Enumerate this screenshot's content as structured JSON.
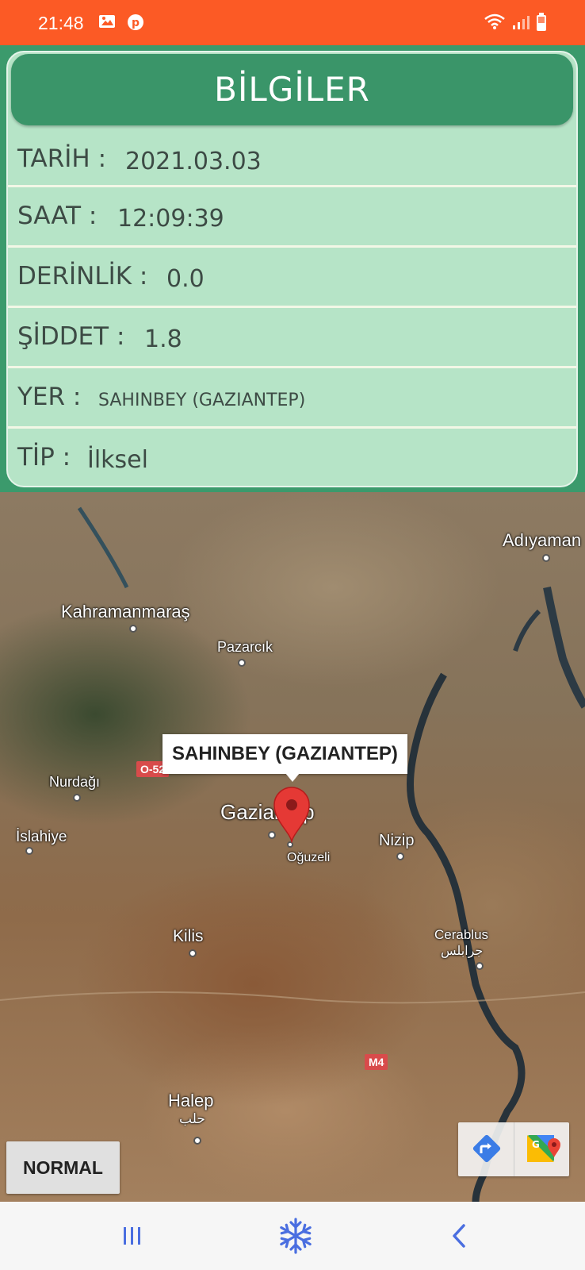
{
  "status_bar": {
    "time": "21:48",
    "left_icons": [
      "image-icon",
      "pinterest-icon"
    ],
    "right_icons": [
      "wifi-icon",
      "signal-icon",
      "battery-icon"
    ],
    "color": "#fc5a25"
  },
  "info_panel": {
    "title": "BİLGİLER",
    "rows": [
      {
        "label": "TARİH :",
        "value": "2021.03.03"
      },
      {
        "label": "SAAT :",
        "value": "12:09:39"
      },
      {
        "label": "DERİNLİK :",
        "value": "0.0"
      },
      {
        "label": "ŞİDDET :",
        "value": "1.8"
      },
      {
        "label": "YER :",
        "value": "SAHINBEY (GAZIANTEP)"
      },
      {
        "label": "TİP :",
        "value": "İlksel"
      }
    ],
    "header_color": "#3a9569",
    "panel_color": "#b6e4c7"
  },
  "map": {
    "marker_title": "SAHINBEY (GAZIANTEP)",
    "places": [
      "Adıyaman",
      "Kahramanmaraş",
      "Pazarcık",
      "Nurdağı",
      "İslahiye",
      "Gaziantep",
      "Oğuzeli",
      "Nizip",
      "Kilis",
      "Cerablus",
      "جرابلس",
      "Halep",
      "حلب"
    ],
    "road_badges": [
      "O-52",
      "M4"
    ],
    "map_type_button": "NORMAL",
    "toolbar_icons": [
      "directions-icon",
      "google-maps-icon"
    ]
  },
  "nav_bar": {
    "icons": [
      "recent-apps-icon",
      "home-snowflake-icon",
      "back-icon"
    ]
  }
}
